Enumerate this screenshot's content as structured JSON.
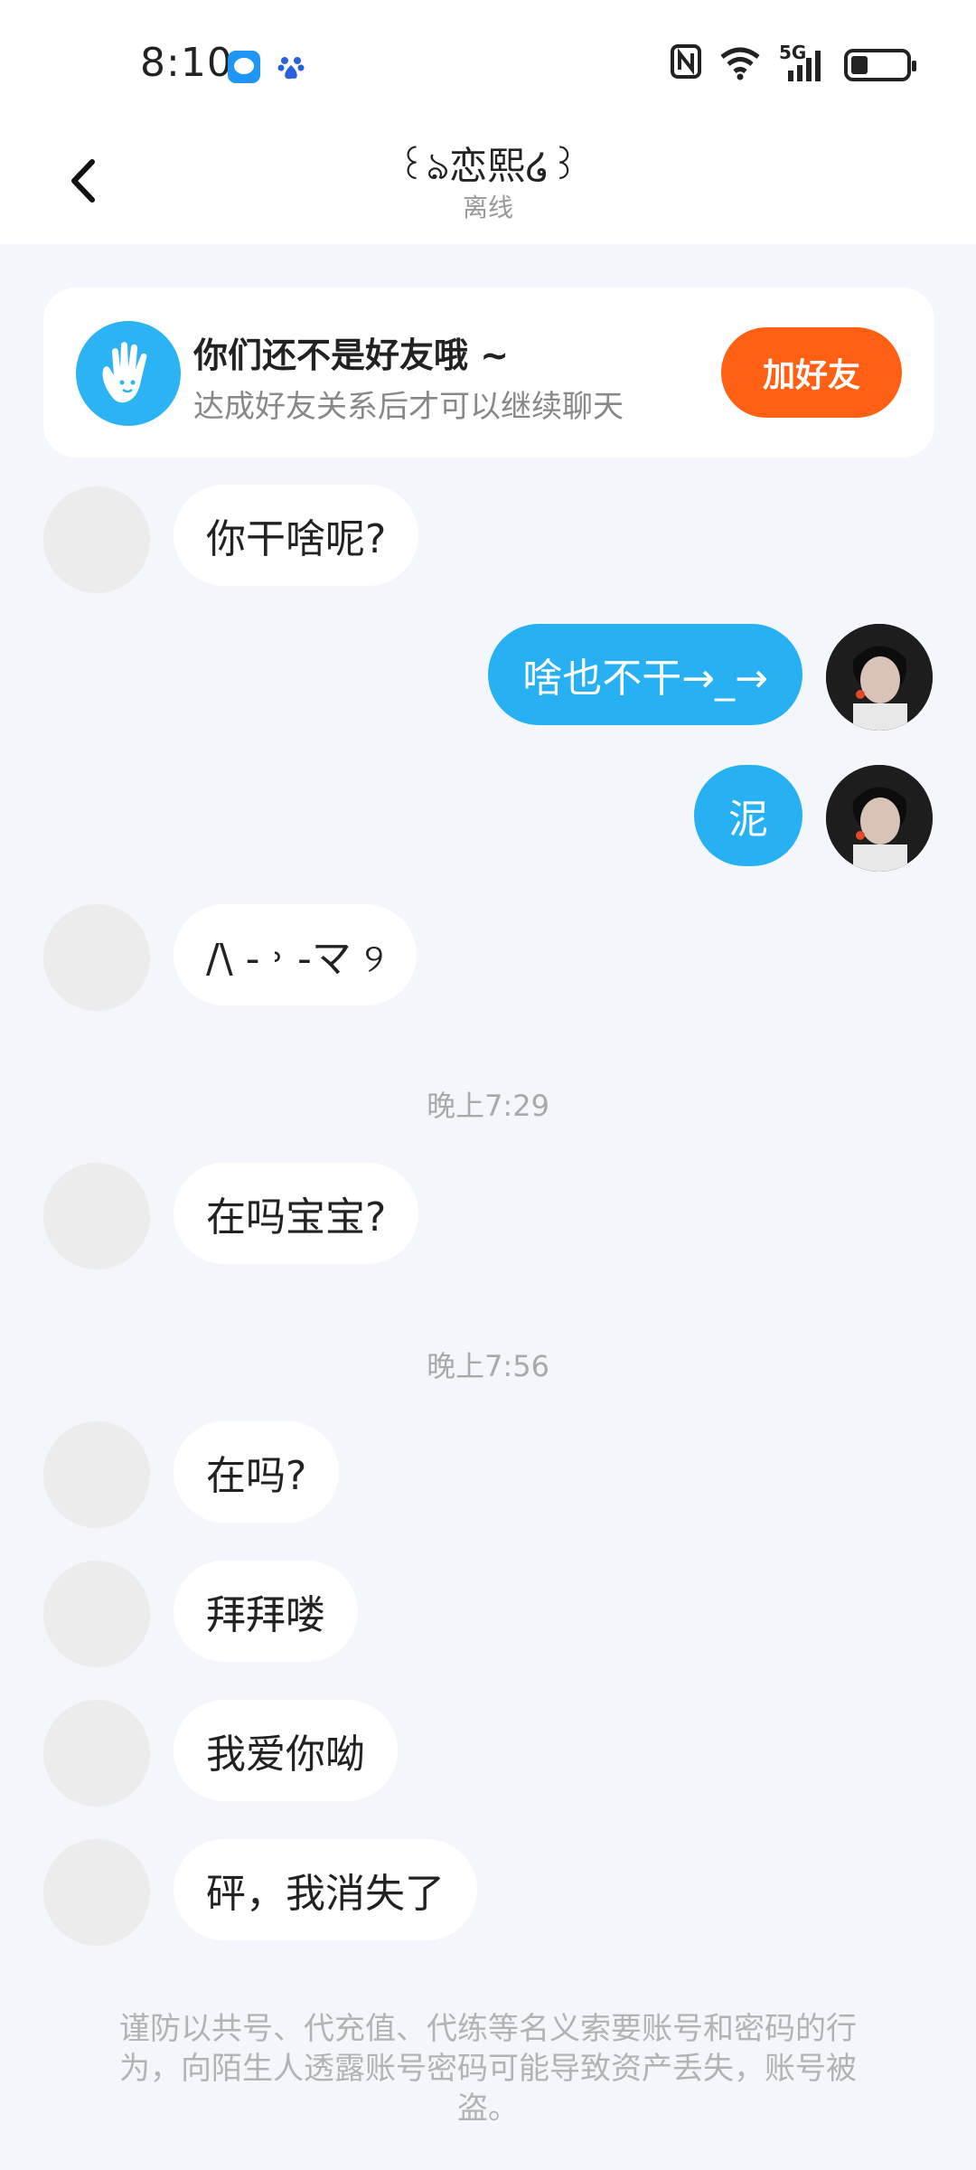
{
  "status_bar": {
    "time": "8:10",
    "network": "5G"
  },
  "header": {
    "title": "꒰ঌ恋熙໒꒱",
    "subtitle": "离线"
  },
  "friend_notice": {
    "title": "你们还不是好友哦 ~",
    "subtitle": "达成好友关系后才可以继续聊天",
    "button_label": "加好友"
  },
  "messages": [
    {
      "side": "in",
      "text": "你干啥呢?"
    },
    {
      "side": "out",
      "text": "啥也不干→_→"
    },
    {
      "side": "out",
      "text": "泥"
    },
    {
      "side": "in",
      "text": "/\\ - ˒ -マ ୨"
    },
    {
      "side": "in",
      "text": "在吗宝宝?"
    },
    {
      "side": "in",
      "text": "在吗?"
    },
    {
      "side": "in",
      "text": "拜拜喽"
    },
    {
      "side": "in",
      "text": "我爱你呦"
    },
    {
      "side": "in",
      "text": "砰，我消失了"
    }
  ],
  "timestamps": [
    "晚上7:29",
    "晚上7:56"
  ],
  "disclaimer": "谨防以共号、代充值、代练等名义索要账号和密码的行为，向陌生人透露账号密码可能导致资产丢失，账号被盗。",
  "colors": {
    "outgoing_bubble": "#28b1f2",
    "add_friend_button": "#ff6013",
    "background": "#f3f6fa"
  }
}
